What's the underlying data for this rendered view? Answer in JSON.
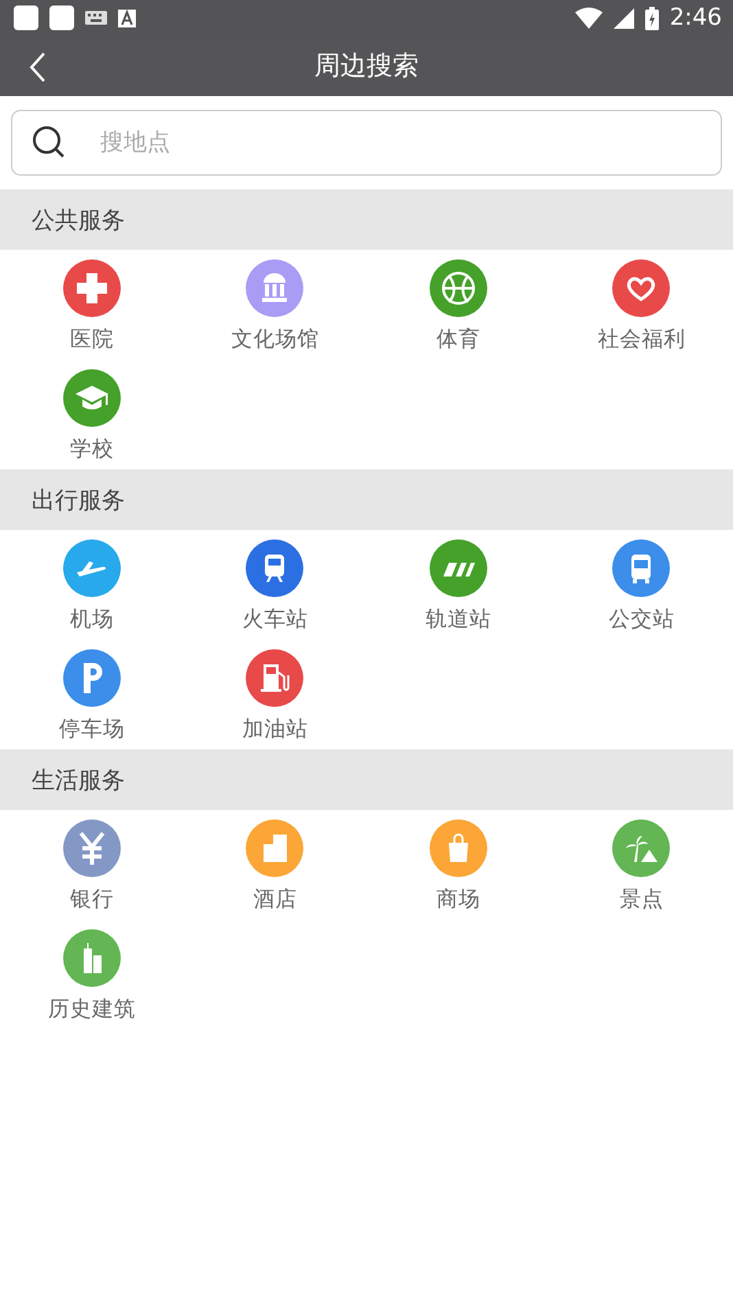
{
  "status_bar": {
    "time": "2:46"
  },
  "header": {
    "title": "周边搜索"
  },
  "search": {
    "placeholder": "搜地点"
  },
  "sections": [
    {
      "title": "公共服务",
      "items": [
        {
          "label": "医院",
          "color": "#e84a4a"
        },
        {
          "label": "文化场馆",
          "color": "#a99cf5"
        },
        {
          "label": "体育",
          "color": "#45a12a"
        },
        {
          "label": "社会福利",
          "color": "#e84a4a"
        },
        {
          "label": "学校",
          "color": "#45a12a"
        }
      ]
    },
    {
      "title": "出行服务",
      "items": [
        {
          "label": "机场",
          "color": "#27a9ec"
        },
        {
          "label": "火车站",
          "color": "#2c6fe3"
        },
        {
          "label": "轨道站",
          "color": "#45a12a"
        },
        {
          "label": "公交站",
          "color": "#3c8eea"
        },
        {
          "label": "停车场",
          "color": "#3c8eea"
        },
        {
          "label": "加油站",
          "color": "#e84a4a"
        }
      ]
    },
    {
      "title": "生活服务",
      "items": [
        {
          "label": "银行",
          "color": "#8498c6"
        },
        {
          "label": "酒店",
          "color": "#fba636"
        },
        {
          "label": "商场",
          "color": "#fba636"
        },
        {
          "label": "景点",
          "color": "#63b653"
        },
        {
          "label": "历史建筑",
          "color": "#63b653"
        }
      ]
    }
  ]
}
